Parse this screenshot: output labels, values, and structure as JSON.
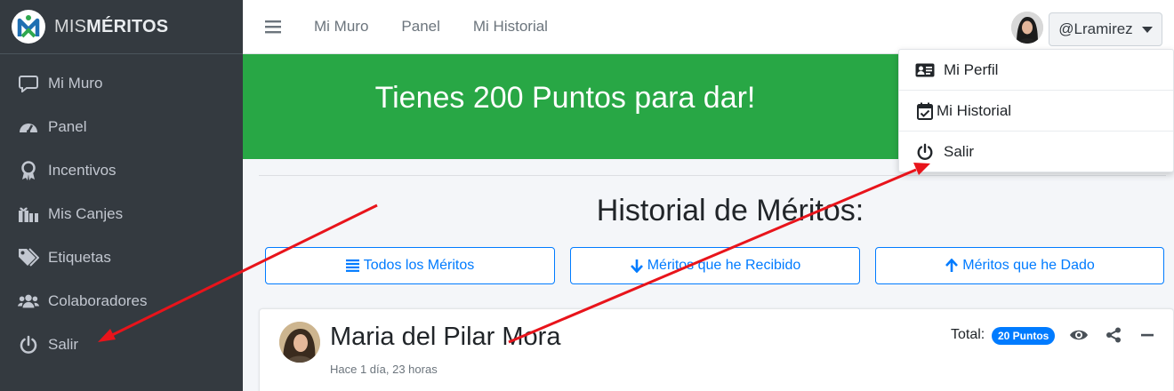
{
  "brand": {
    "prefix": "MIS",
    "bold": "MÉRITOS"
  },
  "sidebar": {
    "items": [
      {
        "label": "Mi Muro",
        "icon": "comment-icon"
      },
      {
        "label": "Panel",
        "icon": "tachometer-icon"
      },
      {
        "label": "Incentivos",
        "icon": "award-icon"
      },
      {
        "label": "Mis Canjes",
        "icon": "gifts-icon"
      },
      {
        "label": "Etiquetas",
        "icon": "tags-icon"
      },
      {
        "label": "Colaboradores",
        "icon": "users-icon"
      },
      {
        "label": "Salir",
        "icon": "power-icon"
      }
    ]
  },
  "topbar": {
    "links": [
      "Mi Muro",
      "Panel",
      "Mi Historial"
    ],
    "username": "@Lramirez"
  },
  "banner": {
    "text": "Tienes 200 Puntos para dar!"
  },
  "historial": {
    "title": "Historial de Méritos:",
    "buttons": [
      "Todos los Méritos",
      "Méritos que he Recibido",
      "Méritos que he Dado"
    ]
  },
  "card": {
    "name": "Maria del Pilar Mora",
    "time": "Hace 1 día, 23 horas",
    "total_label": "Total:",
    "points_badge": "20 Puntos"
  },
  "dropdown": {
    "items": [
      "Mi Perfil",
      "Mi Historial",
      "Salir"
    ]
  },
  "colors": {
    "sidebar_bg": "#343a40",
    "banner_green": "#28a745",
    "primary_blue": "#007bff",
    "annotation_red": "#e8141b"
  }
}
